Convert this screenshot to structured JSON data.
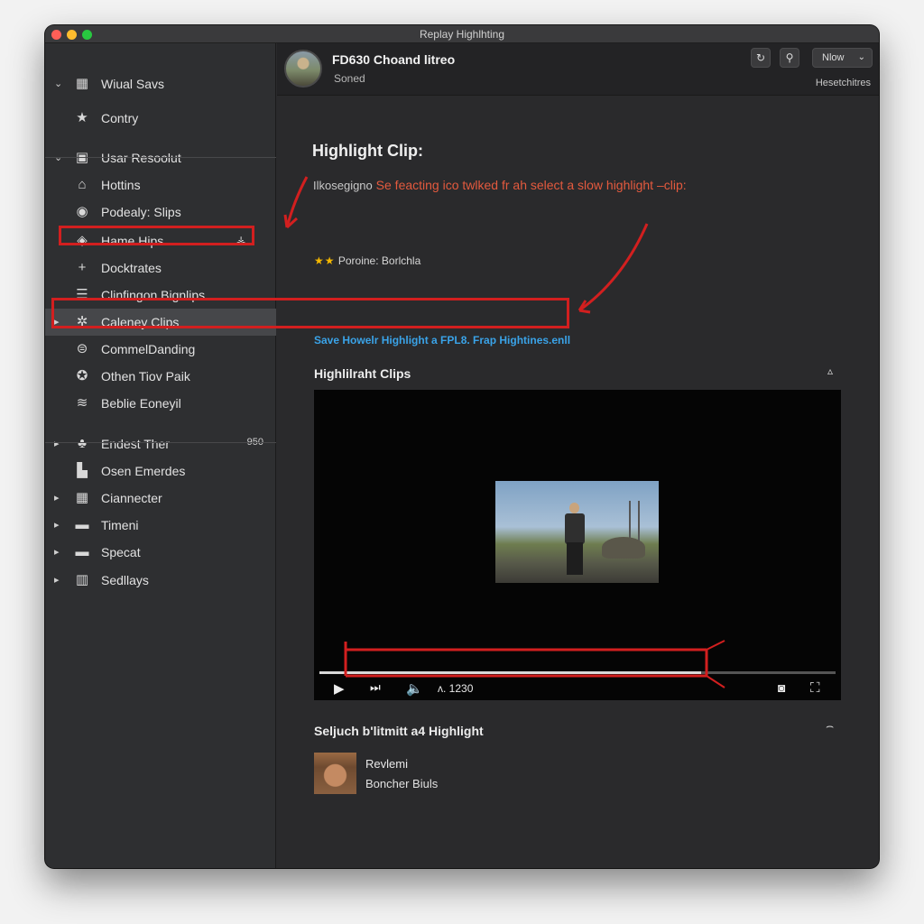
{
  "window": {
    "title": "Replay Highlhting"
  },
  "sidebar": {
    "items": [
      {
        "label": "Wiual Savs",
        "icon": "gallery-icon",
        "glyph": "▦",
        "chevron": "⌄"
      },
      {
        "label": "Contry",
        "icon": "star-icon",
        "glyph": "★",
        "chevron": ""
      },
      {
        "label": "Usar Resoolut",
        "icon": "folder-icon",
        "glyph": "▣",
        "chevron": "⌄"
      },
      {
        "label": "Hottins",
        "icon": "home-icon",
        "glyph": "⌂",
        "chevron": ""
      },
      {
        "label": "Podealy: Slips",
        "icon": "info-icon",
        "glyph": "◉",
        "chevron": ""
      },
      {
        "label": "Hame Hips",
        "icon": "clip-icon",
        "glyph": "◈",
        "chevron": "",
        "trail": "⚶"
      },
      {
        "label": "Docktrates",
        "icon": "plus-icon",
        "glyph": "+",
        "chevron": ""
      },
      {
        "label": "Clinfingon Bignlips",
        "icon": "list-icon",
        "glyph": "☰",
        "chevron": ""
      },
      {
        "label": "Caleney Clips",
        "icon": "settings-icon",
        "glyph": "✲",
        "chevron": "▸"
      },
      {
        "label": "CommelDanding",
        "icon": "globe-icon",
        "glyph": "⊜",
        "chevron": ""
      },
      {
        "label": "Othen Tiov Paik",
        "icon": "badge-icon",
        "glyph": "✪",
        "chevron": ""
      },
      {
        "label": "Beblie Eoneyil",
        "icon": "stack-icon",
        "glyph": "≋",
        "chevron": ""
      },
      {
        "label": "Endest Ther",
        "icon": "people-icon",
        "glyph": "♣",
        "chevron": "▸",
        "badge": "950"
      },
      {
        "label": "Osen Emerdes",
        "icon": "lock-icon",
        "glyph": "▙",
        "chevron": ""
      },
      {
        "label": "Ciannecter",
        "icon": "grid-icon",
        "glyph": "▦",
        "chevron": "▸"
      },
      {
        "label": "Timeni",
        "icon": "folder-icon",
        "glyph": "▬",
        "chevron": "▸"
      },
      {
        "label": "Specat",
        "icon": "folder-icon",
        "glyph": "▬",
        "chevron": "▸"
      },
      {
        "label": "Sedllays",
        "icon": "books-icon",
        "glyph": "▥",
        "chevron": "▸"
      }
    ]
  },
  "header": {
    "title": "FD630 Choand litreo",
    "subtitle": "Soned",
    "select_value": "Nlow",
    "right_label": "Hesetchitres"
  },
  "main": {
    "section_title": "Highlight Clip:",
    "instruction_prefix": "Ilkosegigno",
    "instruction": "Se feacting ico twlked fr ah select a slow highlight –clip:",
    "rating_stars": "★★",
    "rating_text": "Poroine: Borlchla",
    "save_link": "Save Howelr Highlight a FPL8. Frap Hightines.enll",
    "clips_title": "Highlilraht Clips",
    "player": {
      "time": "ʌ. 1230",
      "progress": 0.74
    },
    "sub_title": "Seljuch b'litmitt a4 Highlight",
    "comment": {
      "name": "Revlemi",
      "text": "Boncher Biuls"
    }
  }
}
